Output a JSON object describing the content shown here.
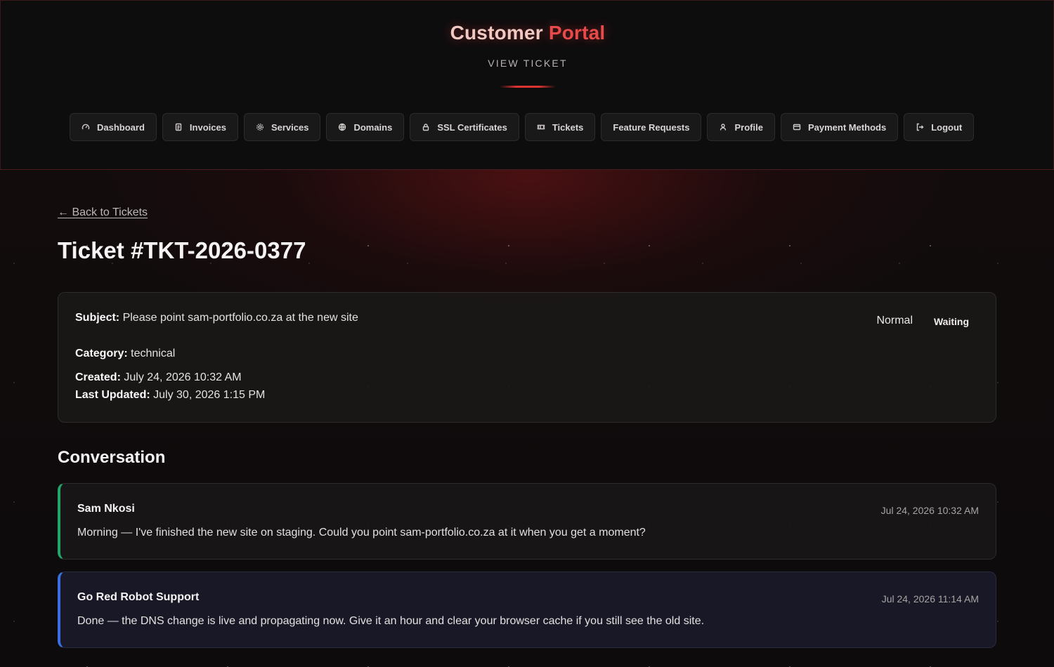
{
  "header": {
    "brand_part1": "Customer ",
    "brand_part2": "Portal",
    "subtitle": "VIEW TICKET"
  },
  "nav": [
    {
      "label": "Dashboard",
      "icon": "gauge-icon"
    },
    {
      "label": "Invoices",
      "icon": "invoice-icon"
    },
    {
      "label": "Services",
      "icon": "gear-icon"
    },
    {
      "label": "Domains",
      "icon": "globe-icon"
    },
    {
      "label": "SSL Certificates",
      "icon": "lock-icon"
    },
    {
      "label": "Tickets",
      "icon": "ticket-icon"
    },
    {
      "label": "Feature Requests",
      "icon": ""
    },
    {
      "label": "Profile",
      "icon": "user-icon"
    },
    {
      "label": "Payment Methods",
      "icon": "credit-card-icon"
    },
    {
      "label": "Logout",
      "icon": "logout-icon"
    }
  ],
  "back_link": "← Back to Tickets",
  "ticket": {
    "title": "Ticket #TKT-2026-0377",
    "subject_label": "Subject:",
    "subject": "Please point sam-portfolio.co.za at the new site",
    "category_label": "Category:",
    "category": "technical",
    "created_label": "Created:",
    "created": "July 24, 2026 10:32 AM",
    "updated_label": "Last Updated:",
    "updated": "July 30, 2026 1:15 PM",
    "priority": "Normal",
    "status": "Waiting"
  },
  "conversation": {
    "title": "Conversation",
    "messages": [
      {
        "author": "Sam Nkosi",
        "time": "Jul 24, 2026 10:32 AM",
        "body": "Morning — I've finished the new site on staging. Could you point sam-portfolio.co.za at it when you get a moment?",
        "accent": "#22a56a"
      },
      {
        "author": "Go Red Robot Support",
        "time": "Jul 24, 2026 11:14 AM",
        "body": "Done — the DNS change is live and propagating now. Give it an hour and clear your browser cache if you still see the old site.",
        "accent": "#3b6fe0"
      }
    ]
  },
  "colors": {
    "brand_accent": "#e84a4a",
    "customer_accent": "#22a56a",
    "support_accent": "#3b6fe0"
  }
}
